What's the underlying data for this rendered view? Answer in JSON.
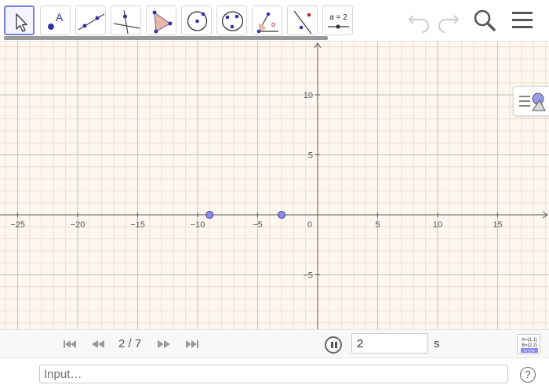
{
  "toolbar": {
    "tools": [
      {
        "name": "move-tool"
      },
      {
        "name": "point-tool",
        "letter": "A"
      },
      {
        "name": "line-tool"
      },
      {
        "name": "perpendicular-line-tool"
      },
      {
        "name": "polygon-tool"
      },
      {
        "name": "circle-tool"
      },
      {
        "name": "conic-tool"
      },
      {
        "name": "angle-tool",
        "letter": "α"
      },
      {
        "name": "reflect-tool"
      },
      {
        "name": "slider-tool",
        "label": "a = 2"
      }
    ],
    "buttons": [
      "undo-icon",
      "redo-icon",
      "search-icon",
      "menu-icon"
    ]
  },
  "graphics": {
    "x_tick_labels": [
      "−25",
      "−20",
      "−15",
      "−10",
      "−5",
      "0",
      "5",
      "10",
      "15"
    ],
    "y_tick_labels": [
      "10",
      "5",
      "−5"
    ],
    "points": [
      {
        "x": -9,
        "y": 0
      },
      {
        "x": -3,
        "y": 0
      }
    ],
    "colors": {
      "background": "#fdf7ef",
      "minor_grid": "#f2dccb",
      "major_grid": "#c0c0c0",
      "point_fill": "#8a8af0",
      "point_stroke": "#3b3b7a"
    }
  },
  "animation": {
    "page_indicator": "2 / 7",
    "speed_value": "2",
    "speed_unit": "s"
  },
  "input_bar": {
    "placeholder": "Input…",
    "help_label": "?"
  },
  "algebra_toggle": {
    "lines": [
      "A=(1,1)",
      "B=(2,2)",
      "a: y=x"
    ]
  }
}
